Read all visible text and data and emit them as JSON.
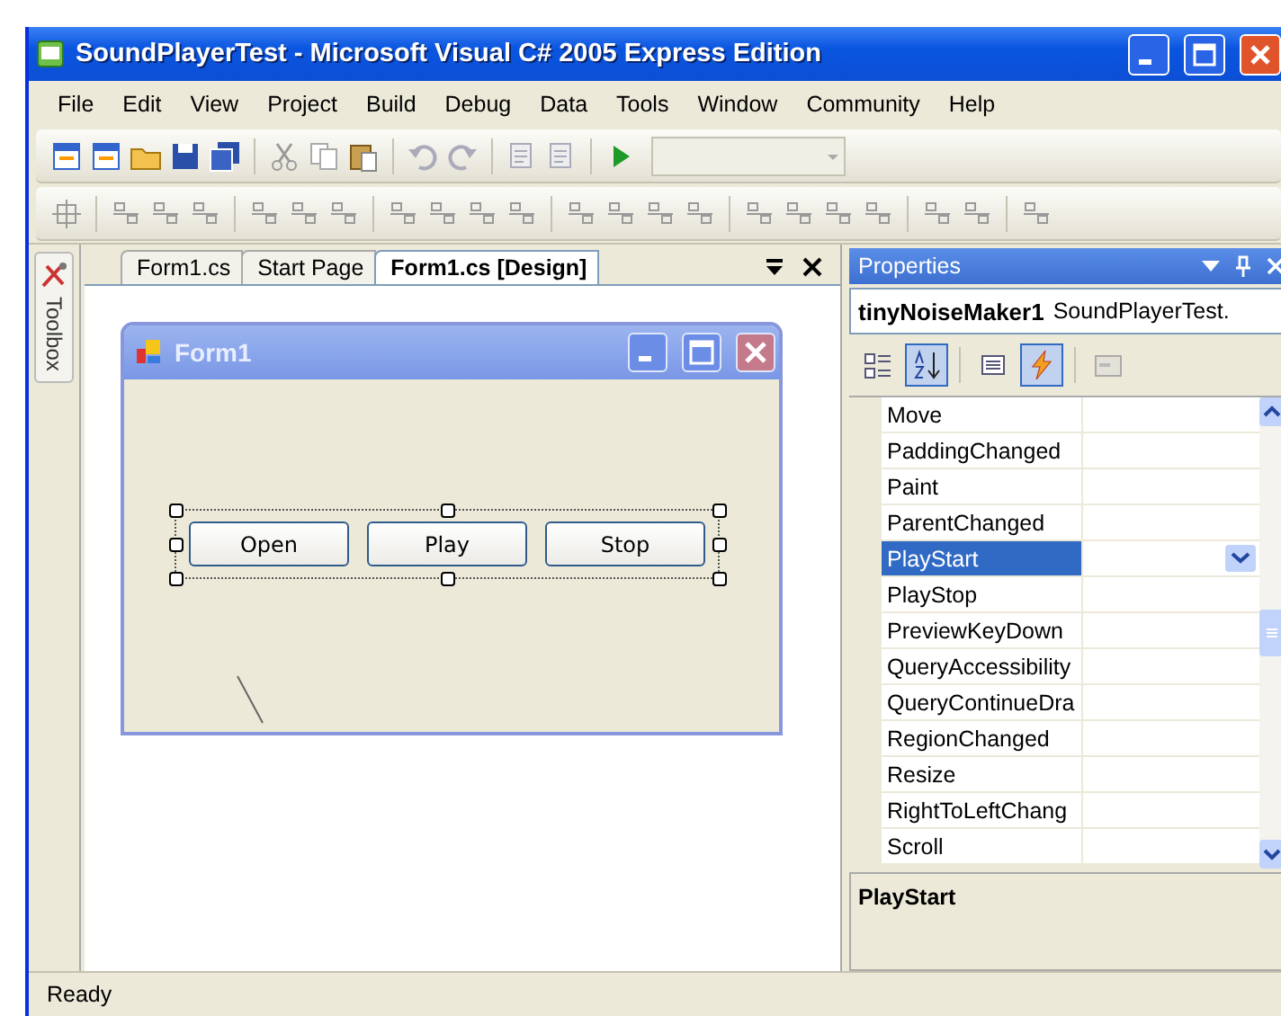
{
  "window": {
    "title": "SoundPlayerTest - Microsoft Visual C# 2005 Express Edition"
  },
  "menu": [
    "File",
    "Edit",
    "View",
    "Project",
    "Build",
    "Debug",
    "Data",
    "Tools",
    "Window",
    "Community",
    "Help"
  ],
  "toolbox": {
    "label": "Toolbox"
  },
  "tabs": [
    {
      "label": "Form1.cs",
      "selected": false
    },
    {
      "label": "Start Page",
      "selected": false
    },
    {
      "label": "Form1.cs [Design]",
      "selected": true
    }
  ],
  "designer": {
    "form_title": "Form1",
    "buttons": [
      "Open",
      "Play",
      "Stop"
    ]
  },
  "properties": {
    "title": "Properties",
    "object_name": "tinyNoiseMaker1",
    "object_type": "SoundPlayerTest.",
    "tools": [
      {
        "kind": "categorized",
        "selected": false
      },
      {
        "kind": "alphabetical",
        "selected": true
      },
      {
        "kind": "properties",
        "selected": false
      },
      {
        "kind": "events",
        "selected": true
      },
      {
        "kind": "pages",
        "selected": false
      }
    ],
    "rows": [
      {
        "name": "Move",
        "selected": false
      },
      {
        "name": "PaddingChanged",
        "selected": false
      },
      {
        "name": "Paint",
        "selected": false
      },
      {
        "name": "ParentChanged",
        "selected": false
      },
      {
        "name": "PlayStart",
        "selected": true
      },
      {
        "name": "PlayStop",
        "selected": false
      },
      {
        "name": "PreviewKeyDown",
        "selected": false
      },
      {
        "name": "QueryAccessibility",
        "selected": false
      },
      {
        "name": "QueryContinueDra",
        "selected": false
      },
      {
        "name": "RegionChanged",
        "selected": false
      },
      {
        "name": "Resize",
        "selected": false
      },
      {
        "name": "RightToLeftChang",
        "selected": false
      },
      {
        "name": "Scroll",
        "selected": false
      }
    ],
    "description": "PlayStart"
  },
  "status_bar": {
    "text": "Ready"
  }
}
